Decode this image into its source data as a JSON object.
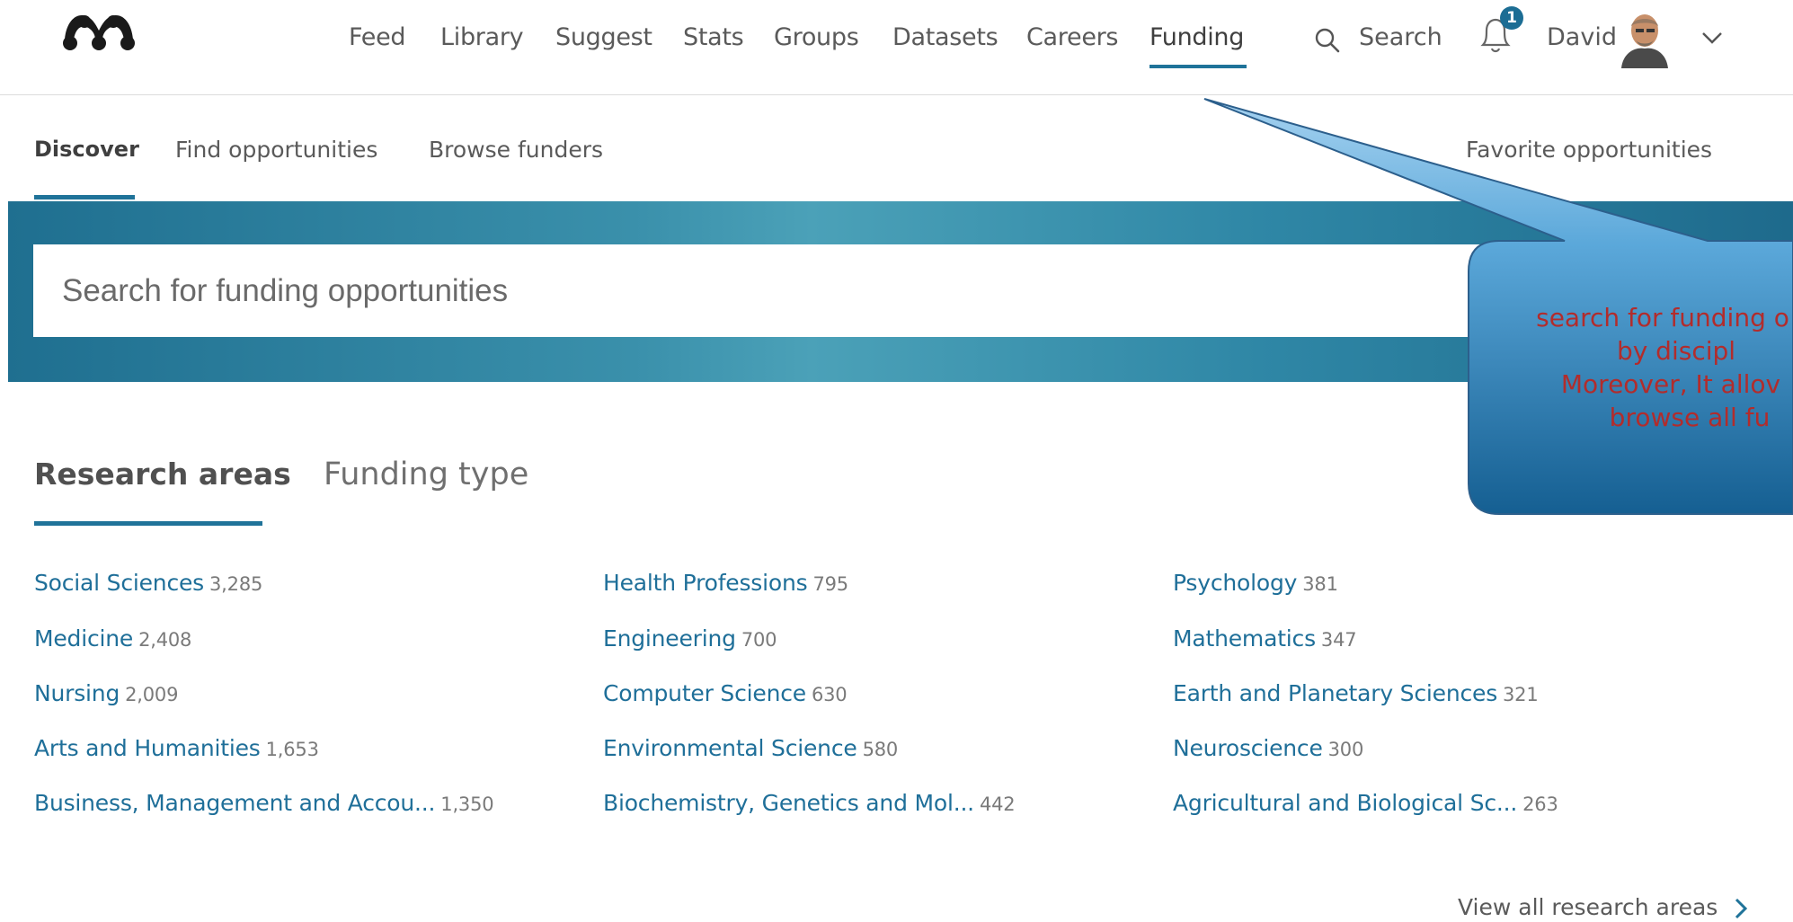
{
  "header": {
    "nav": [
      "Feed",
      "Library",
      "Suggest",
      "Stats",
      "Groups",
      "Datasets",
      "Careers",
      "Funding"
    ],
    "active_nav": "Funding",
    "search_label": "Search",
    "notification_count": "1",
    "user_name": "David",
    "icons": {
      "logo": "mendeley-logo-icon",
      "search": "search-icon",
      "bell": "bell-icon",
      "avatar": "avatar",
      "chevron": "chevron-down-icon"
    }
  },
  "subnav": {
    "items": [
      "Discover",
      "Find opportunities",
      "Browse funders"
    ],
    "active": "Discover",
    "favorites": "Favorite opportunities"
  },
  "hero": {
    "search_placeholder": "Search for funding opportunities"
  },
  "tabs": {
    "research_areas": "Research areas",
    "funding_type": "Funding type",
    "active": "Research areas"
  },
  "areas": {
    "col1": [
      {
        "name": "Social Sciences",
        "count": "3,285"
      },
      {
        "name": "Medicine",
        "count": "2,408"
      },
      {
        "name": "Nursing",
        "count": "2,009"
      },
      {
        "name": "Arts and Humanities",
        "count": "1,653"
      },
      {
        "name": "Business, Management and Accou...",
        "count": "1,350"
      }
    ],
    "col2": [
      {
        "name": "Health Professions",
        "count": "795"
      },
      {
        "name": "Engineering",
        "count": "700"
      },
      {
        "name": "Computer Science",
        "count": "630"
      },
      {
        "name": "Environmental Science",
        "count": "580"
      },
      {
        "name": "Biochemistry, Genetics and Mol...",
        "count": "442"
      }
    ],
    "col3": [
      {
        "name": "Psychology",
        "count": "381"
      },
      {
        "name": "Mathematics",
        "count": "347"
      },
      {
        "name": "Earth and Planetary Sciences",
        "count": "321"
      },
      {
        "name": "Neuroscience",
        "count": "300"
      },
      {
        "name": "Agricultural and Biological Sc...",
        "count": "263"
      }
    ]
  },
  "view_all": "View all research areas",
  "callout": {
    "lines": [
      "search for funding o",
      "by discipl",
      "Moreover, It allov",
      "browse all fu"
    ]
  },
  "colors": {
    "accent": "#1f7399",
    "link": "#1f6f99",
    "callout_text": "#b22c2c"
  }
}
